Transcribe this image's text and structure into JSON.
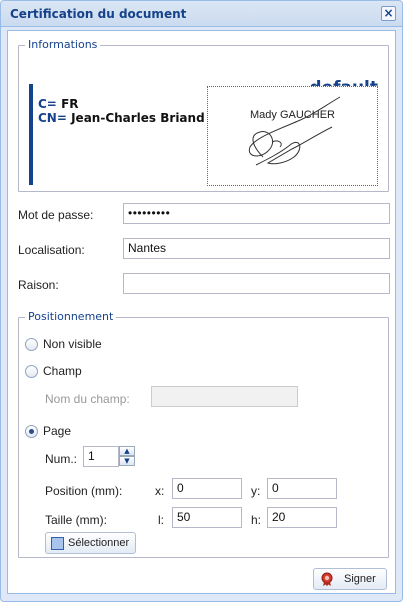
{
  "window": {
    "title": "Certification du document",
    "close_glyph": "×"
  },
  "informations": {
    "legend": "Informations",
    "profile_label": "default",
    "country_key": "C=",
    "country_value": "FR",
    "cn_key": "CN=",
    "cn_value": "Jean-Charles Briand",
    "signature_name": "Mady GAUCHER"
  },
  "form": {
    "password_label": "Mot de passe:",
    "password_value": "•••••••••",
    "location_label": "Localisation:",
    "location_value": "Nantes",
    "reason_label": "Raison:",
    "reason_value": ""
  },
  "positioning": {
    "legend": "Positionnement",
    "option_non_visible": "Non visible",
    "option_field": "Champ",
    "field_name_label": "Nom du champ:",
    "field_name_value": "",
    "option_page": "Page",
    "selected_option": "Page",
    "num_label": "Num.:",
    "num_value": "1",
    "position_label": "Position (mm):",
    "x_label": "x:",
    "x_value": "0",
    "y_label": "y:",
    "y_value": "0",
    "size_label": "Taille (mm):",
    "l_label": "l:",
    "l_value": "50",
    "h_label": "h:",
    "h_value": "20",
    "select_button": "Sélectionner"
  },
  "actions": {
    "sign_button": "Signer"
  },
  "icons": {
    "close": "close-icon",
    "select": "select-area-icon",
    "sign": "seal-icon"
  },
  "colors": {
    "accent": "#15428b",
    "frame": "#99bbe8",
    "panel": "#dfe8f6"
  }
}
